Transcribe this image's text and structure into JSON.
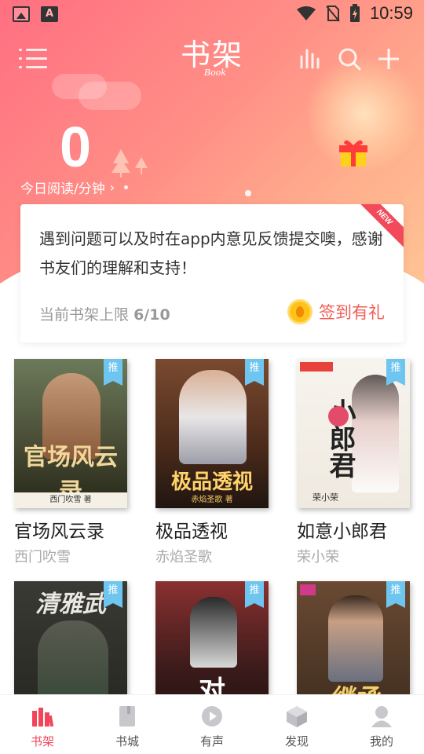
{
  "status_bar": {
    "time": "10:59"
  },
  "header": {
    "title": "书架",
    "subtitle": "Book"
  },
  "reading": {
    "minutes": "0",
    "label": "今日阅读/分钟"
  },
  "notice": {
    "text": "遇到问题可以及时在app内意见反馈提交噢，感谢书友们的理解和支持！",
    "badge": "NEW",
    "shelf_limit_label": "当前书架上限",
    "shelf_limit_value": "6/10",
    "signin_label": "签到有礼"
  },
  "books": [
    {
      "title": "官场风云录",
      "author": "西门吹雪",
      "badge": "推",
      "cover_text": "官场风云录",
      "cover_sub": "西门吹雪 著",
      "cover_color": "#3a3f2e"
    },
    {
      "title": "极品透视",
      "author": "赤焰圣歌",
      "badge": "推",
      "cover_text": "极品透视",
      "cover_sub": "赤焰圣歌 著",
      "cover_color": "#3d2a20"
    },
    {
      "title": "如意小郎君",
      "author": "荣小荣",
      "badge": "推",
      "cover_text": "小郎君",
      "cover_sub": "荣小荣",
      "cover_color": "#f3efe8"
    },
    {
      "title": "",
      "author": "",
      "badge": "推",
      "cover_text": "清雅武",
      "cover_sub": "",
      "cover_color": "#2c2c28"
    },
    {
      "title": "",
      "author": "",
      "badge": "推",
      "cover_text": "对",
      "cover_sub": "",
      "cover_color": "#3a2222"
    },
    {
      "title": "",
      "author": "",
      "badge": "推",
      "cover_text": "继承",
      "cover_sub": "",
      "cover_color": "#5a3c2a"
    }
  ],
  "nav": [
    {
      "label": "书架",
      "icon": "bookshelf-icon",
      "active": true
    },
    {
      "label": "书城",
      "icon": "book-store-icon",
      "active": false
    },
    {
      "label": "有声",
      "icon": "audio-play-icon",
      "active": false
    },
    {
      "label": "发现",
      "icon": "discover-cube-icon",
      "active": false
    },
    {
      "label": "我的",
      "icon": "profile-icon",
      "active": false
    }
  ],
  "colors": {
    "accent": "#f2455a",
    "hero_start": "#ff6f81",
    "hero_end": "#ffc594",
    "badge": "#6ec6f0"
  }
}
